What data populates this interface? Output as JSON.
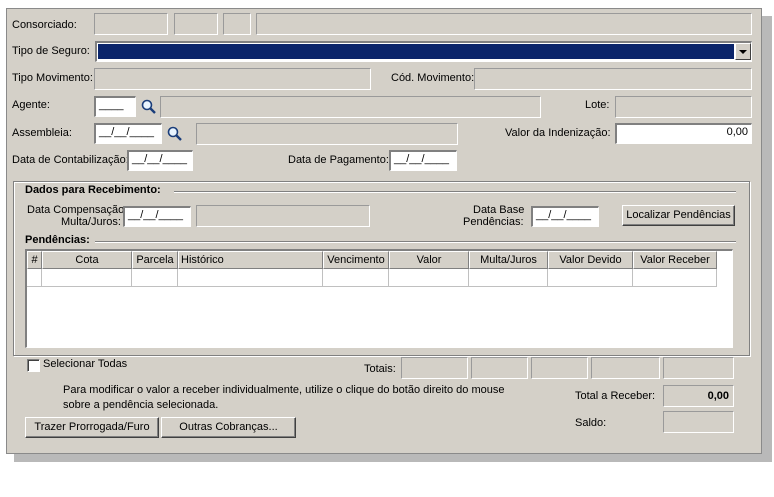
{
  "form": {
    "consorciado_label": "Consorciado:",
    "tipo_seguro_label": "Tipo de Seguro:",
    "tipo_movimento_label": "Tipo Movimento:",
    "cod_movimento_label": "Cód. Movimento:",
    "agente_label": "Agente:",
    "agente_value": "____",
    "lote_label": "Lote:",
    "assembleia_label": "Assembleia:",
    "assembleia_value": "__/__/____",
    "valor_indenizacao_label": "Valor da Indenização:",
    "valor_indenizacao_value": "0,00",
    "data_contabilizacao_label": "Data de Contabilização:",
    "data_contabilizacao_value": "__/__/____",
    "data_pagamento_label": "Data de Pagamento:",
    "data_pagamento_value": "__/__/____"
  },
  "recebimento": {
    "group_title": "Dados para Recebimento:",
    "data_compensacao_label_1": "Data Compensação",
    "data_compensacao_label_2": "Multa/Juros:",
    "data_compensacao_value": "__/__/____",
    "data_base_label_1": "Data Base",
    "data_base_label_2": "Pendências:",
    "data_base_value": "__/__/____",
    "localizar_button": "Localizar Pendências"
  },
  "pendencias": {
    "title": "Pendências:",
    "columns": [
      "#",
      "Cota",
      "Parcela",
      "Histórico",
      "Vencimento",
      "Valor",
      "Multa/Juros",
      "Valor Devido",
      "Valor Receber"
    ]
  },
  "footer": {
    "selecionar_todas": "Selecionar Todas",
    "totais_label": "Totais:",
    "hint_line_1": "Para modificar o valor a receber individualmente, utilize o clique do botão direito do mouse",
    "hint_line_2": "sobre a pendência selecionada.",
    "total_receber_label": "Total a Receber:",
    "total_receber_value": "0,00",
    "saldo_label": "Saldo:",
    "trazer_button": "Trazer Prorrogada/Furo",
    "outras_button": "Outras Cobranças..."
  },
  "colors": {
    "window_bg": "#d4d0c8",
    "selection_blue": "#0a246a"
  }
}
